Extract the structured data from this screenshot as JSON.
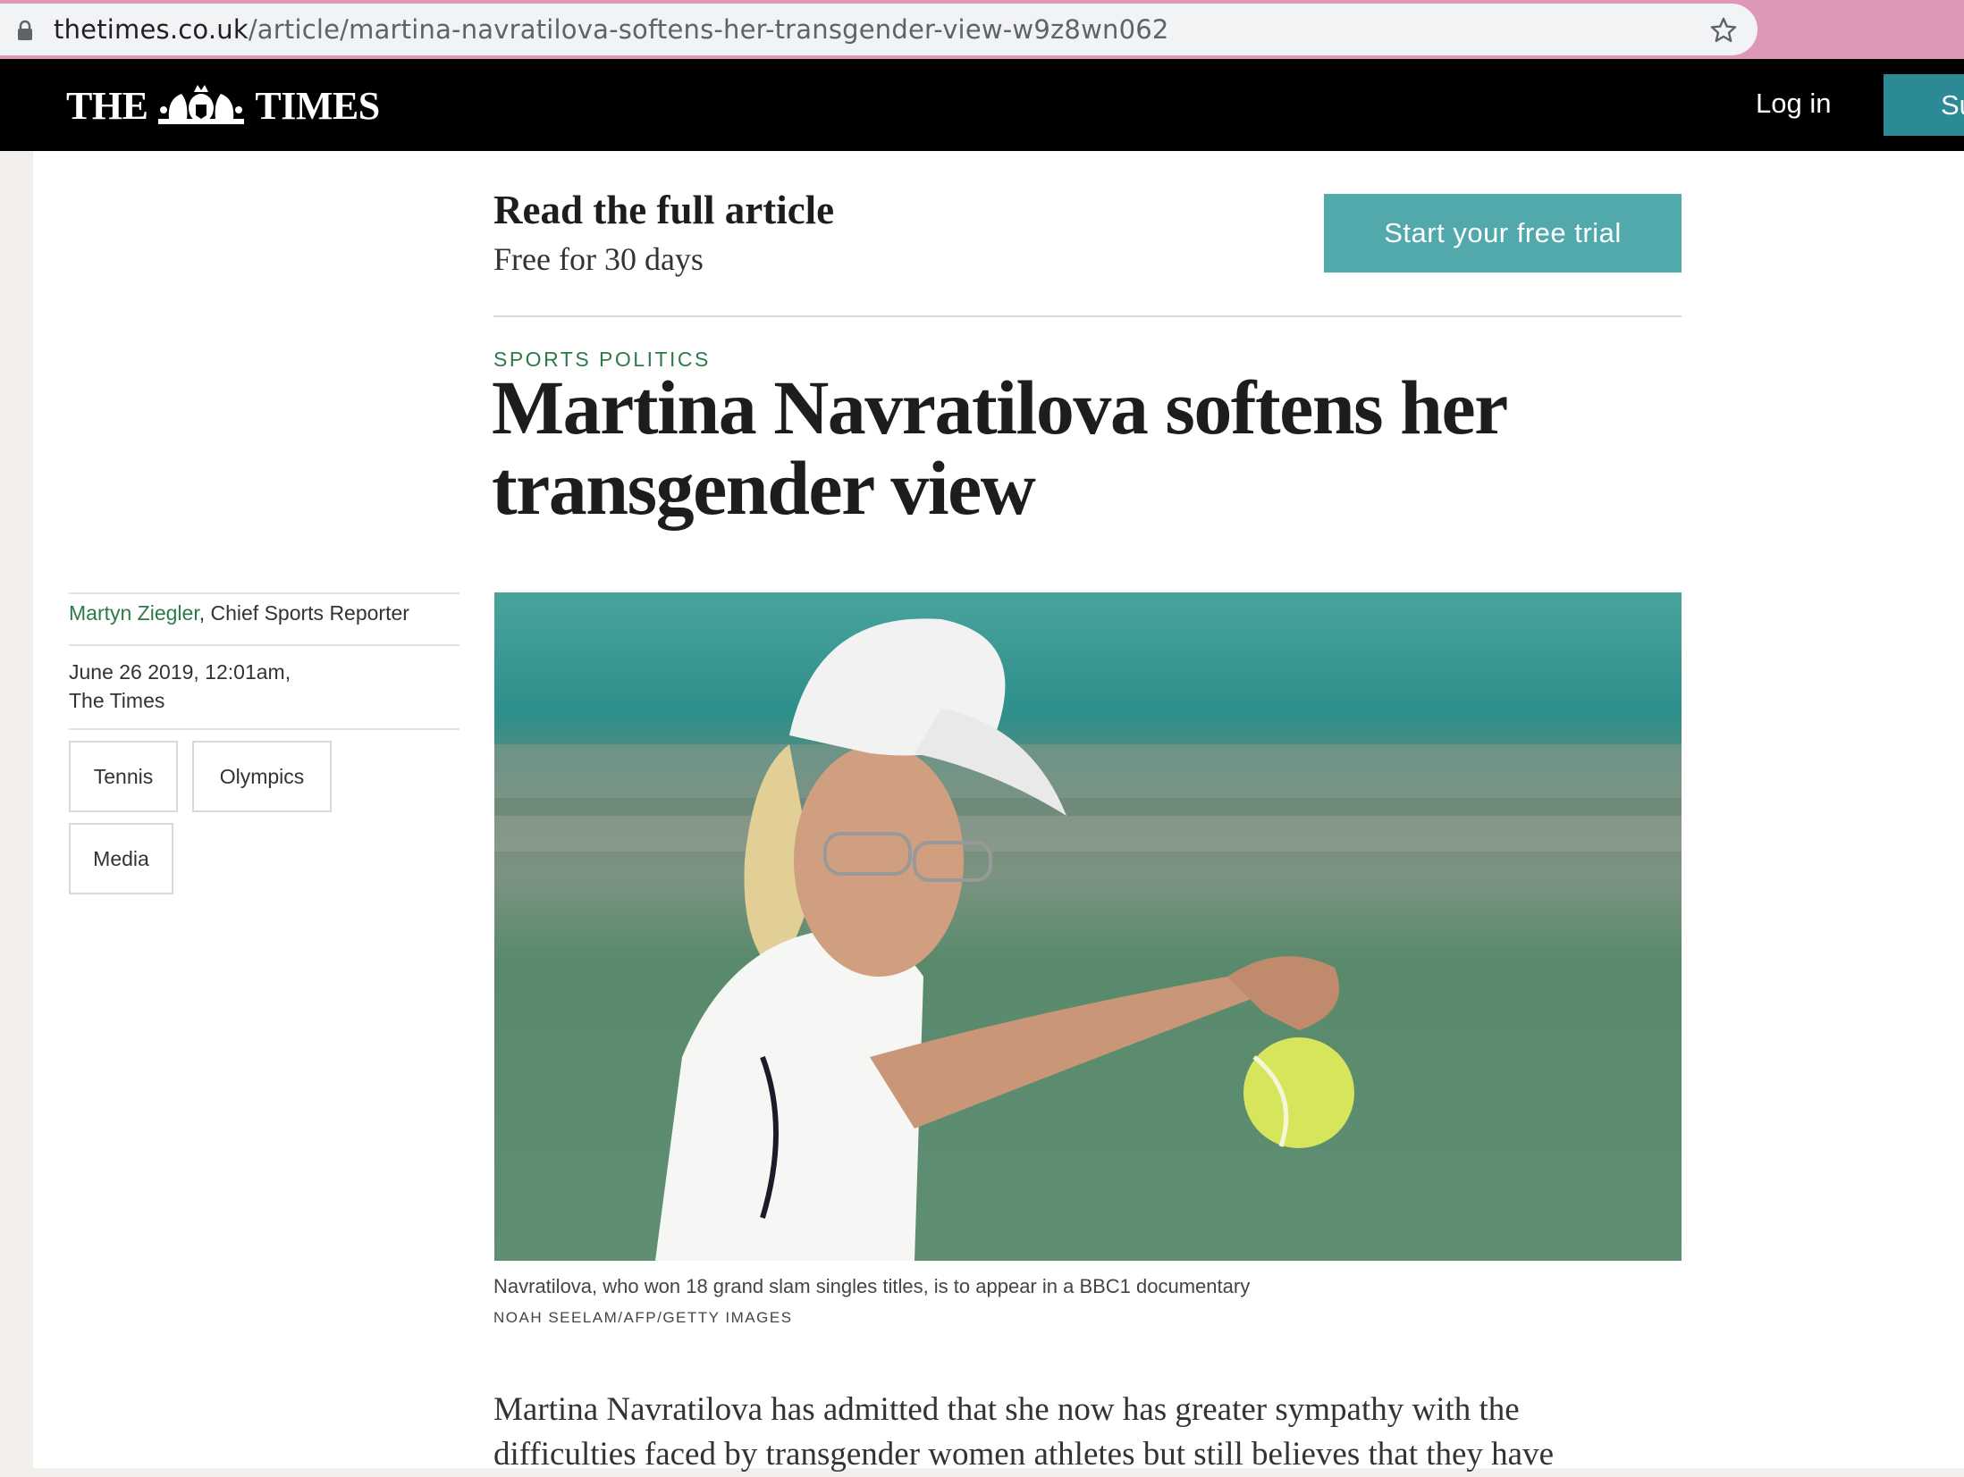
{
  "browser": {
    "url_host": "thetimes.co.uk",
    "url_path": "/article/martina-navratilova-softens-her-transgender-view-w9z8wn062"
  },
  "header": {
    "logo_left": "THE",
    "logo_right": "TIMES",
    "login_label": "Log in",
    "subscribe_label": "Su"
  },
  "promo": {
    "title": "Read the full article",
    "subtitle": "Free for 30 days",
    "button_label": "Start your free trial"
  },
  "article": {
    "section": "SPORTS POLITICS",
    "headline": "Martina Navratilova softens her transgender view",
    "author": "Martyn Ziegler",
    "author_role": ", Chief Sports Reporter",
    "date": "June 26 2019, 12:01am,",
    "publication": "The Times",
    "tags": [
      "Tennis",
      "Olympics",
      "Media"
    ],
    "caption": "Navratilova, who won 18 grand slam singles titles, is to appear in a BBC1 documentary",
    "credit": "NOAH SEELAM/AFP/GETTY IMAGES",
    "body_line1": "Martina Navratilova has admitted that she now has greater sympathy with the",
    "body_line2": "difficulties faced by transgender women athletes but still believes that they have"
  },
  "colors": {
    "accent_teal": "#52a9ac",
    "section_green": "#2c7a4b",
    "masthead": "#000000",
    "browser_frame": "#dd98b8"
  }
}
